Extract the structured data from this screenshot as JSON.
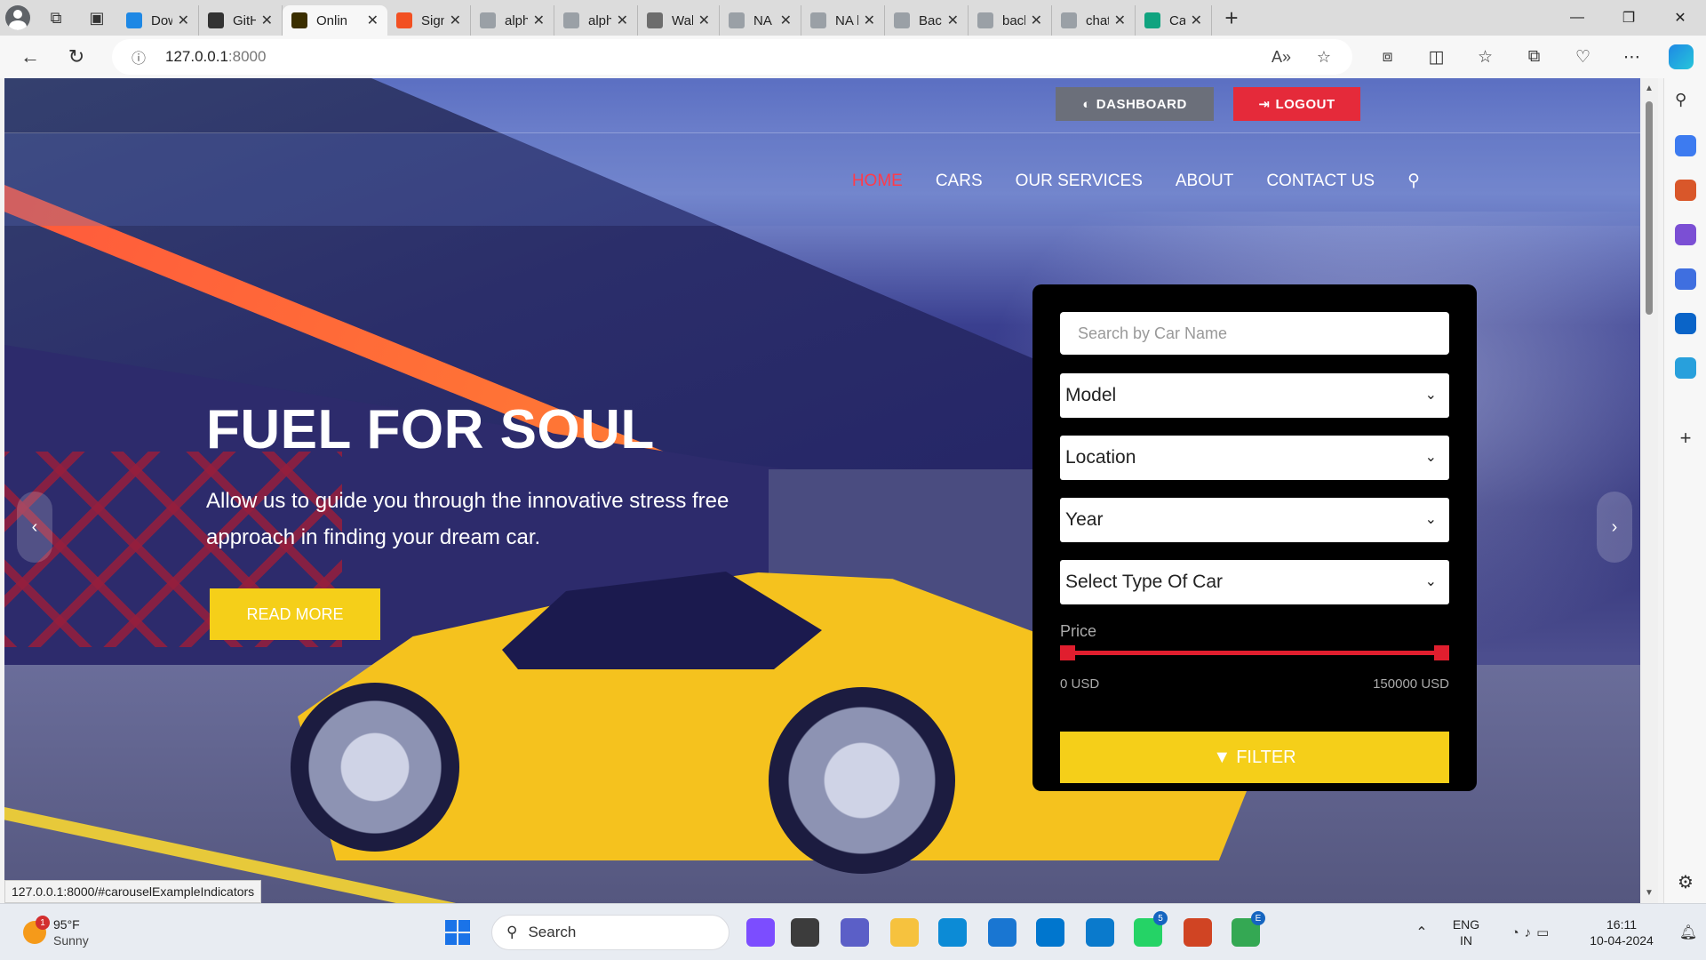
{
  "browser": {
    "tabs": [
      {
        "title": "Dow",
        "color": "#1e88e5",
        "active": false
      },
      {
        "title": "GitH",
        "color": "#333333",
        "active": false
      },
      {
        "title": "Onlin",
        "color": "#3b2f00",
        "active": true
      },
      {
        "title": "Sign",
        "color": "#f25022",
        "active": false
      },
      {
        "title": "alpha",
        "color": "#9aa0a6",
        "active": false
      },
      {
        "title": "alph",
        "color": "#9aa0a6",
        "active": false
      },
      {
        "title": "Wall",
        "color": "#6d6d6d",
        "active": false
      },
      {
        "title": "NA I",
        "color": "#9aa0a6",
        "active": false
      },
      {
        "title": "NA l",
        "color": "#9aa0a6",
        "active": false
      },
      {
        "title": "Back",
        "color": "#9aa0a6",
        "active": false
      },
      {
        "title": "back",
        "color": "#9aa0a6",
        "active": false
      },
      {
        "title": "chat",
        "color": "#9aa0a6",
        "active": false
      },
      {
        "title": "Car R",
        "color": "#10a37f",
        "active": false
      }
    ],
    "url": {
      "host": "127.0.0.1",
      "port": ":8000"
    },
    "status_url": "127.0.0.1:8000/#carouselExampleIndicators"
  },
  "site": {
    "top_buttons": {
      "dashboard": "DASHBOARD",
      "logout": "LOGOUT"
    },
    "nav": {
      "home": "HOME",
      "cars": "CARS",
      "services": "OUR SERVICES",
      "about": "ABOUT",
      "contact": "CONTACT US"
    },
    "hero": {
      "title": "FUEL FOR SOUL",
      "subtitle": "Allow us to guide you through the innovative stress free approach in finding your dream car.",
      "cta": "READ MORE"
    },
    "filter": {
      "search_placeholder": "Search by Car Name",
      "model": "Model",
      "location": "Location",
      "year": "Year",
      "type": "Select Type Of Car",
      "price_label": "Price",
      "price_min": "0 USD",
      "price_max": "150000 USD",
      "button": "FILTER"
    },
    "colors": {
      "accent_red": "#e52a3a",
      "accent_yellow": "#f5cf19"
    }
  },
  "taskbar": {
    "weather": {
      "temp": "95°F",
      "condition": "Sunny",
      "badge": "1"
    },
    "search_placeholder": "Search",
    "apps": [
      {
        "name": "copilot-app-icon",
        "color": "#7c4dff"
      },
      {
        "name": "terminal-app-icon",
        "color": "#3c3c3c"
      },
      {
        "name": "teams-app-icon",
        "color": "#5b5fc7"
      },
      {
        "name": "file-explorer-icon",
        "color": "#f6c23e"
      },
      {
        "name": "edge-app-icon",
        "color": "#0c8bd6"
      },
      {
        "name": "store-app-icon",
        "color": "#1976d2"
      },
      {
        "name": "dell-app-icon",
        "color": "#0076ce"
      },
      {
        "name": "vscode-app-icon",
        "color": "#0a7acc"
      },
      {
        "name": "whatsapp-app-icon",
        "color": "#25d366",
        "badge": "5"
      },
      {
        "name": "powerpoint-app-icon",
        "color": "#d04423"
      },
      {
        "name": "chrome-app-icon",
        "color": "#34a853",
        "badge": "E"
      }
    ],
    "lang": {
      "line1": "ENG",
      "line2": "IN"
    },
    "clock": {
      "time": "16:11",
      "date": "10-04-2024"
    }
  }
}
